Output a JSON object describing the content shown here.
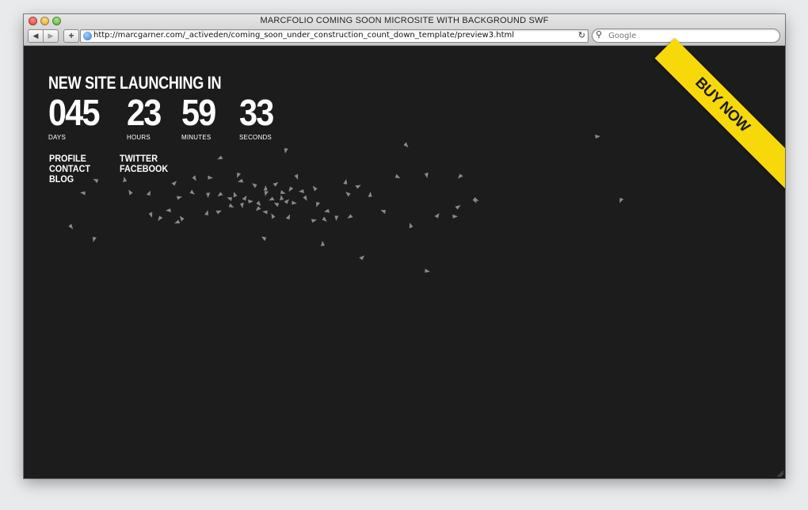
{
  "window": {
    "title": "MARCFOLIO COMING SOON MICROSITE WITH BACKGROUND SWF"
  },
  "toolbar": {
    "back_icon": "◀",
    "forward_icon": "▶",
    "add_icon": "+",
    "url": "http://marcgarner.com/_activeden/coming_soon_under_construction_count_down_template/preview3.html",
    "reload_icon": "↻",
    "search_icon": "⚲",
    "search_placeholder": "Google"
  },
  "page": {
    "headline": "NEW SITE LAUNCHING IN",
    "countdown": {
      "days": {
        "value": "045",
        "label": "DAYS"
      },
      "hours": {
        "value": "23",
        "label": "HOURS"
      },
      "minutes": {
        "value": "59",
        "label": "MINUTES"
      },
      "seconds": {
        "value": "33",
        "label": "SECONDS"
      }
    },
    "links_left": [
      "PROFILE",
      "CONTACT",
      "BLOG"
    ],
    "links_right": [
      "TWITTER",
      "FACEBOOK"
    ],
    "buy_ribbon": "BUY NOW"
  },
  "colors": {
    "background": "#1c1c1c",
    "ribbon": "#f7d90a",
    "particles": "#8a8a8a"
  }
}
